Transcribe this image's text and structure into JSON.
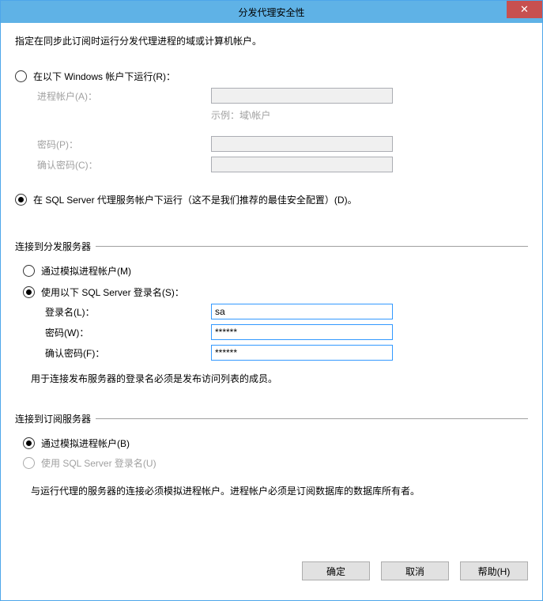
{
  "title": "分发代理安全性",
  "close_glyph": "✕",
  "instruction": "指定在同步此订阅时运行分发代理进程的域或计算机帐户。",
  "runas": {
    "win_label": "在以下 Windows 帐户下运行(R)：",
    "proc_label": "进程帐户(A)：",
    "proc_value": "",
    "example": "示例：域\\帐户",
    "pw_label": "密码(P)：",
    "pw_value": "",
    "cpw_label": "确认密码(C)：",
    "cpw_value": "",
    "sql_label": "在 SQL Server 代理服务帐户下运行（这不是我们推荐的最佳安全配置）(D)。"
  },
  "dist": {
    "header": "连接到分发服务器",
    "imp_label": "通过模拟进程帐户(M)",
    "sql_label": "使用以下 SQL Server 登录名(S)：",
    "login_label": "登录名(L)：",
    "login_value": "sa",
    "pw_label": "密码(W)：",
    "pw_value": "******",
    "cpw_label": "确认密码(F)：",
    "cpw_value": "******",
    "note": "用于连接发布服务器的登录名必须是发布访问列表的成员。"
  },
  "sub": {
    "header": "连接到订阅服务器",
    "imp_label": "通过模拟进程帐户(B)",
    "sql_label": "使用 SQL Server 登录名(U)",
    "note": "与运行代理的服务器的连接必须模拟进程帐户。进程帐户必须是订阅数据库的数据库所有者。"
  },
  "buttons": {
    "ok": "确定",
    "cancel": "取消",
    "help": "帮助(H)"
  }
}
